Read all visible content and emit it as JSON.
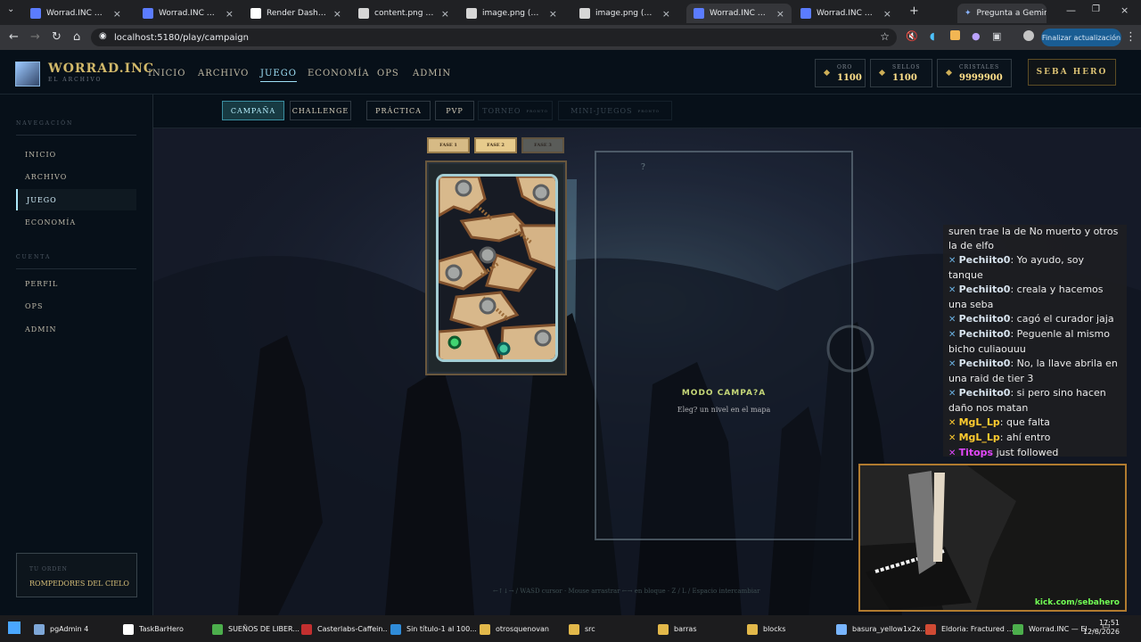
{
  "browser": {
    "tabs": [
      {
        "title": "Worrad.INC — El Arch",
        "icon": "game-tab-icon",
        "color": "#5b7cff"
      },
      {
        "title": "Worrad.INC — El Arch",
        "icon": "game-tab-icon",
        "color": "#5b7cff"
      },
      {
        "title": "Render Dashboard",
        "icon": "render-icon",
        "color": "#ffffff"
      },
      {
        "title": "content.png (1448×1",
        "icon": "globe-icon",
        "color": "#d6d6d6"
      },
      {
        "title": "image.png (498×210)",
        "icon": "globe-icon",
        "color": "#d6d6d6"
      },
      {
        "title": "image.png (489×213)",
        "icon": "globe-icon",
        "color": "#d6d6d6"
      },
      {
        "title": "Worrad.INC — El Arch",
        "icon": "game-tab-icon",
        "color": "#5b7cff"
      },
      {
        "title": "Worrad.INC — El Arch",
        "icon": "game-tab-icon",
        "color": "#5b7cff"
      }
    ],
    "gemini_button": "Pregunta a Gemini",
    "url": "localhost:5180/play/campaign",
    "update_button": "Finalizar actualización"
  },
  "app": {
    "brand_title": "WORRAD.INC",
    "brand_subtitle": "EL ARCHIVO",
    "nav": [
      "INICIO",
      "ARCHIVO",
      "JUEGO",
      "ECONOMÍA",
      "OPS",
      "ADMIN"
    ],
    "active_nav": "JUEGO",
    "stats": [
      {
        "label": "ORO",
        "value": "1100"
      },
      {
        "label": "SELLOS",
        "value": "1100"
      },
      {
        "label": "CRISTALES",
        "value": "9999900"
      }
    ],
    "hero_button": "SEBA HERO",
    "sidebar": {
      "navigation_header": "NAVEGACIÓN",
      "navigation_items": [
        "INICIO",
        "ARCHIVO",
        "JUEGO",
        "ECONOMÍA"
      ],
      "active_item": "JUEGO",
      "account_header": "CUENTA",
      "account_items": [
        "PERFIL",
        "OPS",
        "ADMIN"
      ],
      "order_label": "TU ORDEN",
      "order_name": "ROMPEDORES DEL CIELO"
    },
    "game_modes": [
      {
        "label": "CAMPAÑA",
        "state": "active"
      },
      {
        "label": "CHALLENGE",
        "state": "normal"
      },
      {
        "label": "PRÁCTICA",
        "state": "normal"
      },
      {
        "label": "PVP",
        "state": "normal"
      },
      {
        "label": "TORNEO",
        "state": "disabled",
        "badge": "PRONTO"
      },
      {
        "label": "MINI-JUEGOS",
        "state": "disabled",
        "badge": "PRONTO"
      }
    ],
    "phases": [
      "FASE 1",
      "FASE 2",
      "FASE 3"
    ],
    "panel": {
      "question_mark": "?",
      "title": "MODO CAMPA?A",
      "subtitle": "Eleg? un nivel en el mapa"
    },
    "controls_hint": "←↑↓→ / WASD cursor · Mouse arrastrar ←→ en bloque · Z / L / Espacio intercambiar"
  },
  "stream_overlay": {
    "chat": [
      {
        "user": "",
        "text": "suren trae la de No muerto y otros la de elfo",
        "icon": "",
        "color": "#ffffff"
      },
      {
        "user": "Pechiito0",
        "text": ": Yo ayudo, soy tanque",
        "icon": "kick-icon",
        "color": "#d8e4ef"
      },
      {
        "user": "Pechiito0",
        "text": ": creala y hacemos una seba",
        "icon": "kick-icon",
        "color": "#d8e4ef"
      },
      {
        "user": "Pechiito0",
        "text": ": cagó el curador jaja",
        "icon": "kick-icon",
        "color": "#d8e4ef"
      },
      {
        "user": "Pechiito0",
        "text": ": Peguenle al mismo bicho culiaouuu",
        "icon": "kick-icon",
        "color": "#d8e4ef"
      },
      {
        "user": "Pechiito0",
        "text": ": No, la llave abrila en una raid de tier 3",
        "icon": "kick-icon",
        "color": "#d8e4ef"
      },
      {
        "user": "Pechiito0",
        "text": ": si pero sino hacen daño nos matan",
        "icon": "kick-icon",
        "color": "#d8e4ef"
      },
      {
        "user": "MgL_Lp",
        "text": ": que falta",
        "icon": "kick-icon",
        "color": "#ffcb2f"
      },
      {
        "user": "MgL_Lp",
        "text": ": ahí entro",
        "icon": "kick-icon",
        "color": "#ffcb2f"
      },
      {
        "user": "Titops",
        "text": " just followed",
        "icon": "kick-icon",
        "color": "#e048ff"
      }
    ],
    "webcam_label": "kick.com/sebahero"
  },
  "taskbar": {
    "items": [
      {
        "label": "pgAdmin 4",
        "color": "#7ea7d8"
      },
      {
        "label": "TaskBarHero",
        "color": "#ffffff"
      },
      {
        "label": "SUEÑOS DE LIBER...",
        "color": "#4cae4c"
      },
      {
        "label": "Casterlabs-Caffein...",
        "color": "#c22f2f"
      },
      {
        "label": "Sin título-1 al 100...",
        "color": "#2f8bd8"
      },
      {
        "label": "otrosquenovan",
        "color": "#e2b84a"
      },
      {
        "label": "src",
        "color": "#e2b84a"
      },
      {
        "label": "barras",
        "color": "#e2b84a"
      },
      {
        "label": "blocks",
        "color": "#e2b84a"
      },
      {
        "label": "basura_yellow1x2x...",
        "color": "#78b5ff"
      },
      {
        "label": "Eldoria: Fractured ...",
        "color": "#d04a34"
      },
      {
        "label": "Worrad.INC — El ...",
        "color": "#4cae4c"
      }
    ],
    "time": "17:51",
    "date": "12/8/2026"
  }
}
